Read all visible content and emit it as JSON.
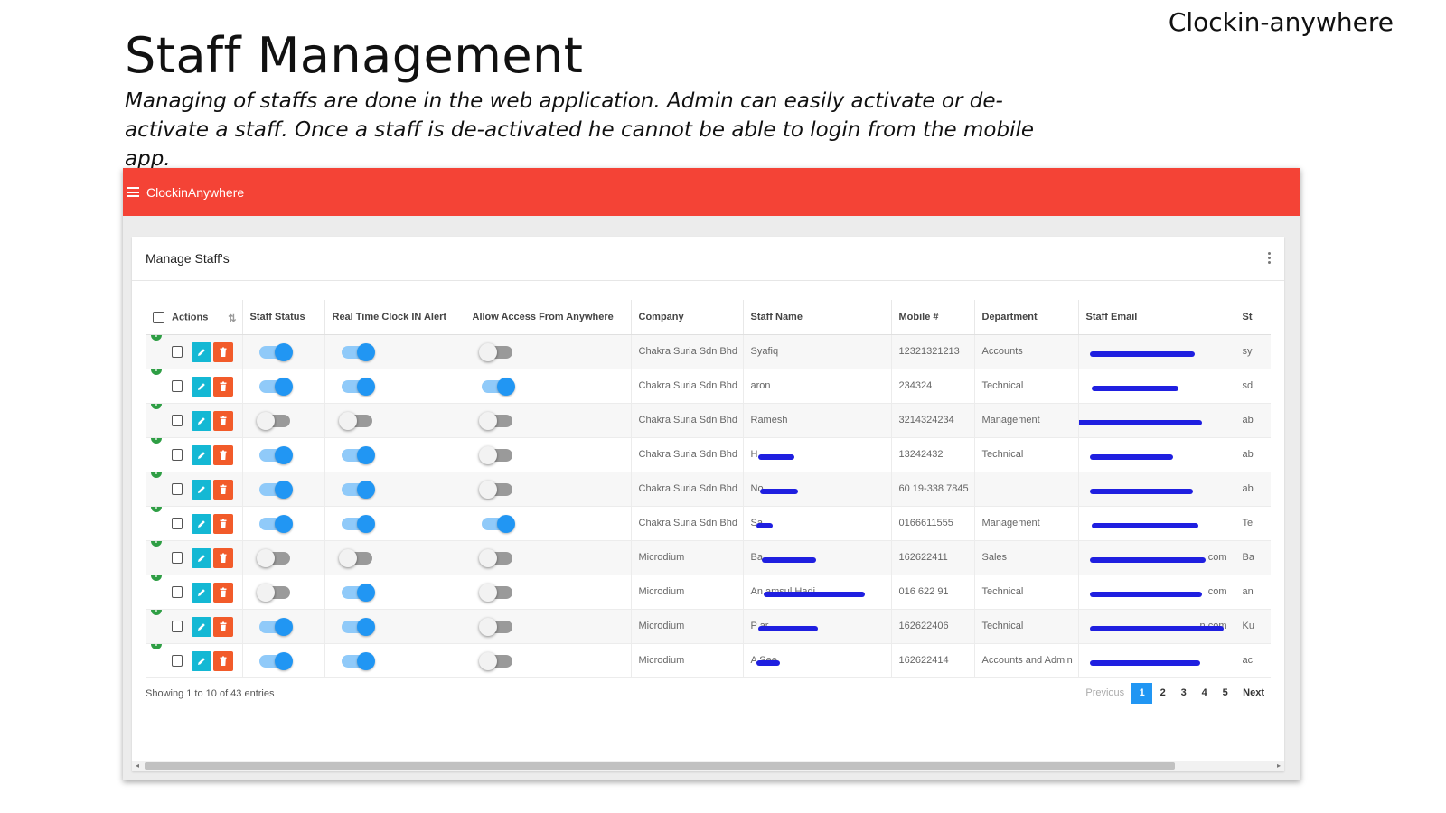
{
  "brand": "Clockin-anywhere",
  "title": "Staff Management",
  "subtitle": "Managing of staffs are done in the web application. Admin can easily activate or de-activate a staff. Once a staff is de-activated he cannot be able to login from the mobile app.",
  "app": {
    "name": "ClockinAnywhere",
    "accent": "#f44336",
    "card_title": "Manage Staff's"
  },
  "table": {
    "columns": [
      "Actions",
      "Staff Status",
      "Real Time Clock IN Alert",
      "Allow Access From Anywhere",
      "Company",
      "Staff Name",
      "Mobile #",
      "Department",
      "Staff Email",
      "St"
    ],
    "rows": [
      {
        "status": true,
        "alert": true,
        "anywhere": false,
        "company": "Chakra Suria Sdn Bhd",
        "name": "Syafiq",
        "mobile": "12321321213",
        "dept": "Accounts",
        "email": "",
        "st": "sy"
      },
      {
        "status": true,
        "alert": true,
        "anywhere": true,
        "company": "Chakra Suria Sdn Bhd",
        "name": "aron",
        "mobile": "234324",
        "dept": "Technical",
        "email": "",
        "st": "sd"
      },
      {
        "status": false,
        "alert": false,
        "anywhere": false,
        "company": "Chakra Suria Sdn Bhd",
        "name": "Ramesh",
        "mobile": "3214324234",
        "dept": "Management",
        "email": "",
        "st": "ab"
      },
      {
        "status": true,
        "alert": true,
        "anywhere": false,
        "company": "Chakra Suria Sdn Bhd",
        "name": "H",
        "mobile": "13242432",
        "dept": "Technical",
        "email": "",
        "st": "ab"
      },
      {
        "status": true,
        "alert": true,
        "anywhere": false,
        "company": "Chakra Suria Sdn Bhd",
        "name": "No",
        "mobile": "60 19-338 7845",
        "dept": "",
        "email": "",
        "st": "ab"
      },
      {
        "status": true,
        "alert": true,
        "anywhere": true,
        "company": "Chakra Suria Sdn Bhd",
        "name": "Sa",
        "mobile": "0166611555",
        "dept": "Management",
        "email": "",
        "st": "Te"
      },
      {
        "status": false,
        "alert": false,
        "anywhere": false,
        "company": "Microdium",
        "name": "Ba",
        "mobile": "162622411",
        "dept": "Sales",
        "email": "com",
        "st": "Ba"
      },
      {
        "status": false,
        "alert": true,
        "anywhere": false,
        "company": "Microdium",
        "name": "An               amsul Hadi",
        "mobile": "016 622 91",
        "dept": "Technical",
        "email": "com",
        "st": "an"
      },
      {
        "status": true,
        "alert": true,
        "anywhere": false,
        "company": "Microdium",
        "name": "P                 ar",
        "mobile": "162622406",
        "dept": "Technical",
        "email": "n.com",
        "st": "Ku"
      },
      {
        "status": true,
        "alert": true,
        "anywhere": false,
        "company": "Microdium",
        "name": "A          See",
        "mobile": "162622414",
        "dept": "Accounts and Admin",
        "email": "",
        "st": "ac"
      }
    ]
  },
  "footer": {
    "showing": "Showing 1 to 10 of 43 entries",
    "previous": "Previous",
    "pages": [
      "1",
      "2",
      "3",
      "4",
      "5"
    ],
    "next": "Next"
  }
}
